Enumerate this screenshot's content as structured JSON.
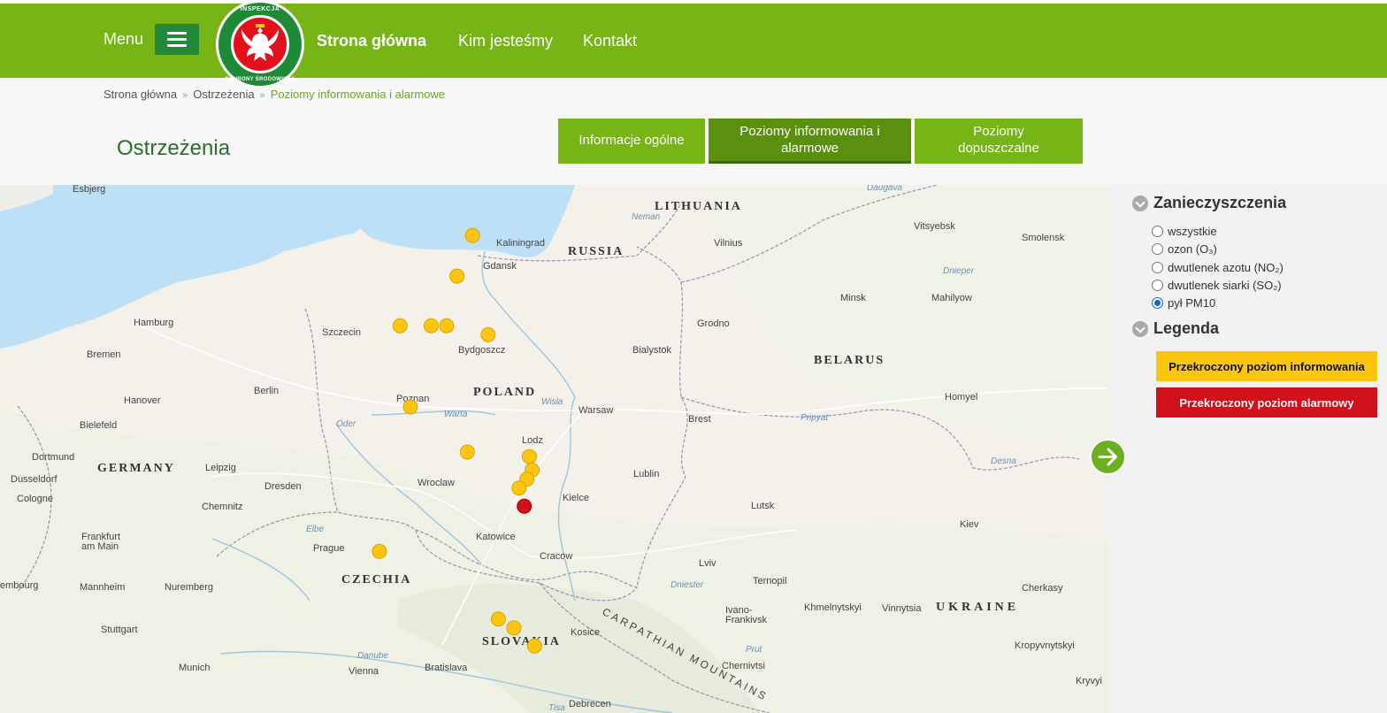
{
  "header": {
    "menu_label": "Menu",
    "logo_top": "INSPEKCJA",
    "logo_bottom": "OCHRONY ŚRODOWISKA",
    "nav": [
      "Strona główna",
      "Kim jesteśmy",
      "Kontakt"
    ]
  },
  "breadcrumb": [
    "Strona główna",
    "Ostrzeżenia",
    "Poziomy informowania i alarmowe"
  ],
  "page_title": "Ostrzeżenia",
  "tabs": [
    {
      "label": "Informacje ogólne",
      "active": false
    },
    {
      "label": "Poziomy informowania i alarmowe",
      "active": true
    },
    {
      "label": "Poziomy dopuszczalne",
      "active": false
    }
  ],
  "sidebar": {
    "pollutants_title": "Zanieczyszczenia",
    "pollutants": [
      {
        "label": "wszystkie",
        "selected": false
      },
      {
        "label": "ozon (O₃)",
        "selected": false
      },
      {
        "label": "dwutlenek azotu (NO₂)",
        "selected": false
      },
      {
        "label": "dwutlenek siarki (SO₂)",
        "selected": false
      },
      {
        "label": "pył PM10",
        "selected": true
      }
    ],
    "legend_title": "Legenda",
    "legend": [
      {
        "label": "Przekroczony poziom informowania",
        "color": "#fcc60e",
        "text_color": "#111111"
      },
      {
        "label": "Przekroczony poziom alarmowy",
        "color": "#d0111b",
        "text_color": "#ffffff"
      }
    ]
  },
  "map": {
    "countries": [
      "LITHUANIA",
      "RUSSIA",
      "POLAND",
      "GERMANY",
      "BELARUS",
      "CZECHIA",
      "SLOVAKIA",
      "UKRAINE"
    ],
    "cities": [
      "Esbjerg",
      "Kaliningrad",
      "Vilnius",
      "Vitsyebsk",
      "Smolensk",
      "Gdansk",
      "Hamburg",
      "Szczecin",
      "Bydgoszcz",
      "Grodno",
      "Minsk",
      "Mahilyow",
      "Bremen",
      "Bialystok",
      "Berlin",
      "Hanover",
      "Poznan",
      "Warsaw",
      "Homyel",
      "Bielefeld",
      "Brest",
      "Lodz",
      "Dortmund",
      "Leipzig",
      "Dusseldorf",
      "Lublin",
      "Wroclaw",
      "Dresden",
      "Cologne",
      "Kielce",
      "Lutsk",
      "Chemnitz",
      "Katowice",
      "Kiev",
      "Frankfurt am Main",
      "Prague",
      "Cracow",
      "Lviv",
      "Ternopil",
      "Mannheim",
      "Nuremberg",
      "Cherkasy",
      "Ivano-Frankivsk",
      "Khmelnytskyi",
      "Vinnytsia",
      "Stuttgart",
      "Kosice",
      "Kropyvnytskyi",
      "Munich",
      "Bratislava",
      "Vienna",
      "Chernivtsi",
      "Kryvyi",
      "Debrecen",
      "Luxembourg"
    ],
    "waters": [
      "Neman",
      "Warta",
      "Wisla",
      "Oder",
      "Pripyat",
      "Desna",
      "Elbe",
      "Danube",
      "Dniester",
      "Prut",
      "Tisa",
      "Daugava",
      "Dnieper"
    ],
    "mountains": "CARPATHIAN MOUNTAINS",
    "stations": [
      {
        "level": "info",
        "lon": 18.3,
        "lat": 54.2
      },
      {
        "level": "info",
        "lon": 18.0,
        "lat": 53.75
      },
      {
        "level": "info",
        "lon": 16.9,
        "lat": 53.2
      },
      {
        "level": "info",
        "lon": 17.5,
        "lat": 53.2
      },
      {
        "level": "info",
        "lon": 17.8,
        "lat": 53.2
      },
      {
        "level": "info",
        "lon": 18.6,
        "lat": 53.1
      },
      {
        "level": "info",
        "lon": 17.1,
        "lat": 52.3
      },
      {
        "level": "info",
        "lon": 18.2,
        "lat": 51.8
      },
      {
        "level": "info",
        "lon": 19.4,
        "lat": 51.75
      },
      {
        "level": "info",
        "lon": 19.45,
        "lat": 51.6
      },
      {
        "level": "info",
        "lon": 19.35,
        "lat": 51.5
      },
      {
        "level": "info",
        "lon": 19.2,
        "lat": 51.4
      },
      {
        "level": "info",
        "lon": 16.5,
        "lat": 50.7
      },
      {
        "level": "info",
        "lon": 18.8,
        "lat": 49.95
      },
      {
        "level": "info",
        "lon": 19.1,
        "lat": 49.85
      },
      {
        "level": "info",
        "lon": 19.5,
        "lat": 49.65
      },
      {
        "level": "alarm",
        "lon": 19.3,
        "lat": 51.2
      }
    ]
  },
  "next_button_label": "→"
}
